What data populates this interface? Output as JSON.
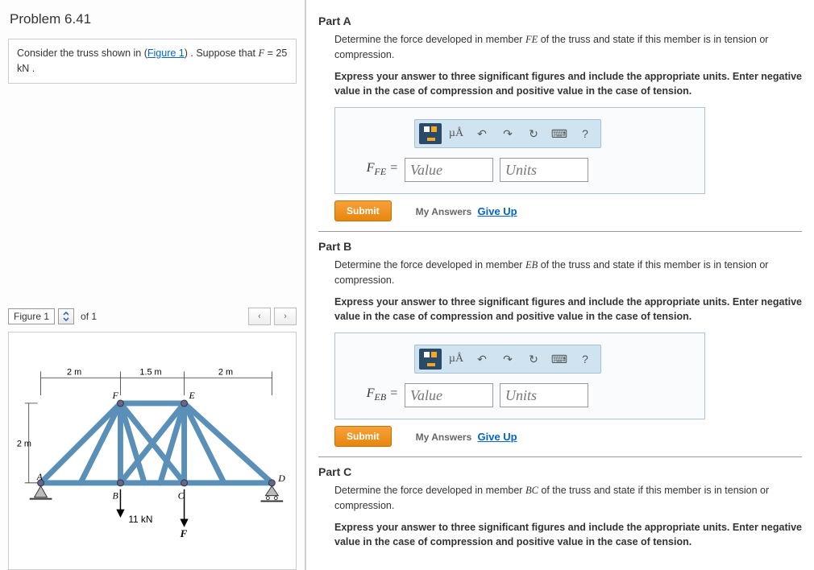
{
  "problem_title": "Problem 6.41",
  "problem_desc_prefix": "Consider the truss shown in (",
  "problem_desc_link": "Figure 1",
  "problem_desc_suffix": ") . Suppose that ",
  "problem_var": "F",
  "problem_value": " = 25  kN .",
  "figure": {
    "label": "Figure 1",
    "of": "of 1",
    "prev": "‹",
    "next": "›",
    "dims": {
      "top_left": "2 m",
      "top_mid": "1.5 m",
      "top_right": "2 m",
      "left_h": "2 m"
    },
    "nodes": {
      "A": "A",
      "B": "B",
      "C": "C",
      "D": "D",
      "E": "E",
      "F": "F"
    },
    "loads": {
      "B": "11 kN",
      "C": "F"
    }
  },
  "parts": {
    "A": {
      "heading": "Part A",
      "text_1": "Determine the force developed in member ",
      "member": "FE",
      "text_2": " of the truss and state if this member is in tension or compression.",
      "bold": "Express your answer to three significant figures and include the appropriate units. Enter negative value in the case of compression and positive value in the case of tension.",
      "var_label": "F",
      "var_sub": "FE",
      "eq": " = ",
      "value_ph": "Value",
      "units_ph": "Units"
    },
    "B": {
      "heading": "Part B",
      "text_1": "Determine the force developed in member ",
      "member": "EB",
      "text_2": " of the truss and state if this member is in tension or compression.",
      "bold": "Express your answer to three significant figures and include the appropriate units. Enter negative value in the case of compression and positive value in the case of tension.",
      "var_label": "F",
      "var_sub": "EB",
      "eq": " = ",
      "value_ph": "Value",
      "units_ph": "Units"
    },
    "C": {
      "heading": "Part C",
      "text_1": "Determine the force developed in member ",
      "member": "BC",
      "text_2": " of the truss and state if this member is in tension or compression.",
      "bold": "Express your answer to three significant figures and include the appropriate units. Enter negative value in the case of compression and positive value in the case of tension."
    }
  },
  "toolbar": {
    "mu": "µÅ",
    "undo": "↶",
    "redo": "↷",
    "reset": "↻",
    "keyboard": "⌨",
    "help": "?"
  },
  "buttons": {
    "submit": "Submit",
    "my_answers": "My Answers",
    "give_up": "Give Up"
  }
}
